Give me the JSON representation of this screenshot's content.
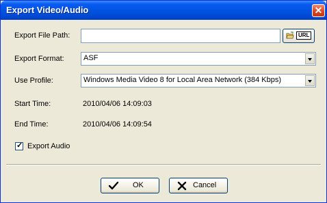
{
  "window": {
    "title": "Export Video/Audio",
    "close_glyph": "✕"
  },
  "form": {
    "export_file_path": {
      "label": "Export File Path:",
      "value": "",
      "button_label": "URL",
      "button_icon": "folder-open-icon"
    },
    "export_format": {
      "label": "Export Format:",
      "selected": "ASF"
    },
    "use_profile": {
      "label": "Use Profile:",
      "selected": "Windows Media Video 8 for Local Area Network (384 Kbps)"
    },
    "start_time": {
      "label": "Start Time:",
      "value": "2010/04/06 14:09:03"
    },
    "end_time": {
      "label": "End Time:",
      "value": "2010/04/06 14:09:54"
    },
    "export_audio": {
      "label": "Export Audio",
      "checked": true,
      "mark": "✓"
    }
  },
  "buttons": {
    "ok": {
      "label": "OK",
      "icon": "checkmark-icon"
    },
    "cancel": {
      "label": "Cancel",
      "icon": "x-mark-icon"
    }
  },
  "colors": {
    "titlebar": "#0054e3",
    "dialog_bg": "#ece9d8",
    "field_border": "#7f9db9",
    "close_button": "#d8421c"
  }
}
